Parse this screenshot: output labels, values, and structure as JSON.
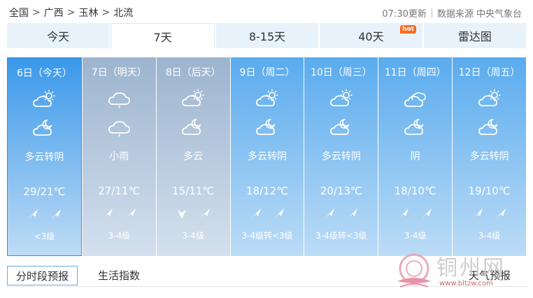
{
  "breadcrumb": {
    "items": [
      "全国",
      "广西",
      "玉林",
      "北流"
    ],
    "separator": ">"
  },
  "meta": {
    "updated": "07:30更新",
    "source": "数据来源 中央气象台"
  },
  "tabs": [
    {
      "label": "今天",
      "active": false
    },
    {
      "label": "7天",
      "active": true
    },
    {
      "label": "8-15天",
      "active": false
    },
    {
      "label": "40天",
      "active": false,
      "badge": "hot"
    },
    {
      "label": "雷达图",
      "active": false
    }
  ],
  "colors": {
    "today_top": "#3a98ea",
    "today_bottom": "#bfdcf6",
    "rain_top": "#9cb4cf",
    "rain_bottom": "#d4e0ee",
    "normal_top": "#5aabee",
    "normal_bottom": "#bcdcf6",
    "hot_badge": "#ff6a21"
  },
  "days": [
    {
      "date": "6日（今天）",
      "am_icon": "partly-cloudy-icon",
      "pm_icon": "partly-cloudy-night-icon",
      "desc": "多云转阴",
      "temp": "29/21℃",
      "wind_am": "wind-arrow-ne-icon",
      "wind_pm": "wind-arrow-ne-icon",
      "level": "<3级",
      "theme": "today"
    },
    {
      "date": "7日（明天）",
      "am_icon": "light-rain-icon",
      "pm_icon": "light-rain-icon",
      "desc": "小雨",
      "temp": "27/11℃",
      "wind_am": "wind-arrow-ne-icon",
      "wind_pm": "wind-arrow-ne-icon",
      "level": "3-4级",
      "theme": "rain"
    },
    {
      "date": "8日（后天）",
      "am_icon": "partly-cloudy-icon",
      "pm_icon": "partly-cloudy-night-icon",
      "desc": "多云",
      "temp": "15/11℃",
      "wind_am": "wind-arrow-n-icon",
      "wind_pm": "wind-arrow-ne-icon",
      "level": "3-4级",
      "theme": "rain"
    },
    {
      "date": "9日（周二）",
      "am_icon": "partly-cloudy-icon",
      "pm_icon": "partly-cloudy-night-icon",
      "desc": "多云转阴",
      "temp": "18/12℃",
      "wind_am": "wind-arrow-ne-icon",
      "wind_pm": "wind-arrow-ne-icon",
      "level": "3-4级转<3级",
      "theme": "normal"
    },
    {
      "date": "10日（周三）",
      "am_icon": "partly-cloudy-icon",
      "pm_icon": "partly-cloudy-night-icon",
      "desc": "多云转阴",
      "temp": "20/13℃",
      "wind_am": "wind-arrow-ne-icon",
      "wind_pm": "wind-arrow-ne-icon",
      "level": "3-4级转<3级",
      "theme": "normal"
    },
    {
      "date": "11日（周四）",
      "am_icon": "overcast-icon",
      "pm_icon": "partly-cloudy-night-icon",
      "desc": "阴",
      "temp": "18/10℃",
      "wind_am": "wind-arrow-ne-icon",
      "wind_pm": "wind-arrow-ne-icon",
      "level": "3-4级",
      "theme": "normal"
    },
    {
      "date": "12日（周五）",
      "am_icon": "partly-cloudy-icon",
      "pm_icon": "partly-cloudy-night-icon",
      "desc": "多云转阴",
      "temp": "19/10℃",
      "wind_am": "wind-arrow-ne-icon",
      "wind_pm": "wind-arrow-ne-icon",
      "level": "3-4级",
      "theme": "normal"
    }
  ],
  "bottom_tabs": {
    "hourly": "分时段预报",
    "life": "生活指数",
    "right": "天气预报"
  },
  "watermark": {
    "text": "铜州网",
    "url": "www.bltzw.com"
  }
}
